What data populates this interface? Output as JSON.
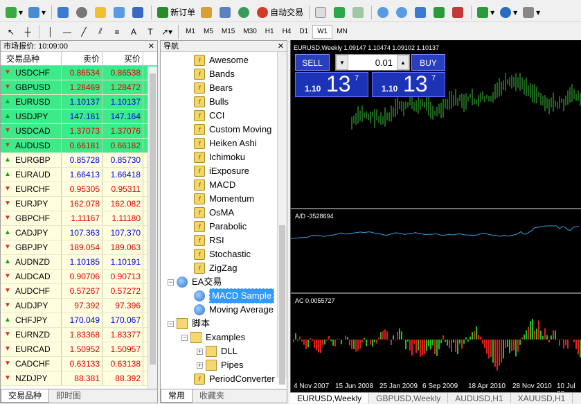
{
  "toolbar": {
    "new_order": "新订单",
    "auto_trading": "自动交易",
    "timeframes": [
      "M1",
      "M5",
      "M15",
      "M30",
      "H1",
      "H4",
      "D1",
      "W1",
      "MN"
    ],
    "active_timeframe": "W1"
  },
  "market_watch": {
    "title": "市场报价: 10:09:00",
    "col_symbol": "交易品种",
    "col_bid": "卖价",
    "col_ask": "买价",
    "rows": [
      {
        "symbol": "USDCHF",
        "bid": "0.86534",
        "ask": "0.86538",
        "dir": "down",
        "color": "red",
        "hl": true
      },
      {
        "symbol": "GBPUSD",
        "bid": "1.28469",
        "ask": "1.28472",
        "dir": "down",
        "color": "red",
        "hl": true
      },
      {
        "symbol": "EURUSD",
        "bid": "1.10137",
        "ask": "1.10137",
        "dir": "up",
        "color": "blue",
        "hl": true
      },
      {
        "symbol": "USDJPY",
        "bid": "147.161",
        "ask": "147.164",
        "dir": "up",
        "color": "blue",
        "hl": true
      },
      {
        "symbol": "USDCAD",
        "bid": "1.37073",
        "ask": "1.37076",
        "dir": "down",
        "color": "red",
        "hl": true
      },
      {
        "symbol": "AUDUSD",
        "bid": "0.66181",
        "ask": "0.66182",
        "dir": "down",
        "color": "red",
        "hl": true
      },
      {
        "symbol": "EURGBP",
        "bid": "0.85728",
        "ask": "0.85730",
        "dir": "up",
        "color": "blue",
        "hl": false
      },
      {
        "symbol": "EURAUD",
        "bid": "1.66413",
        "ask": "1.66418",
        "dir": "up",
        "color": "blue",
        "hl": false
      },
      {
        "symbol": "EURCHF",
        "bid": "0.95305",
        "ask": "0.95311",
        "dir": "down",
        "color": "red",
        "hl": false
      },
      {
        "symbol": "EURJPY",
        "bid": "162.078",
        "ask": "162.082",
        "dir": "down",
        "color": "red",
        "hl": false
      },
      {
        "symbol": "GBPCHF",
        "bid": "1.11167",
        "ask": "1.11180",
        "dir": "down",
        "color": "red",
        "hl": false
      },
      {
        "symbol": "CADJPY",
        "bid": "107.363",
        "ask": "107.370",
        "dir": "up",
        "color": "blue",
        "hl": false
      },
      {
        "symbol": "GBPJPY",
        "bid": "189.054",
        "ask": "189.063",
        "dir": "down",
        "color": "red",
        "hl": false
      },
      {
        "symbol": "AUDNZD",
        "bid": "1.10185",
        "ask": "1.10191",
        "dir": "up",
        "color": "blue",
        "hl": false
      },
      {
        "symbol": "AUDCAD",
        "bid": "0.90706",
        "ask": "0.90713",
        "dir": "down",
        "color": "red",
        "hl": false
      },
      {
        "symbol": "AUDCHF",
        "bid": "0.57267",
        "ask": "0.57272",
        "dir": "down",
        "color": "red",
        "hl": false
      },
      {
        "symbol": "AUDJPY",
        "bid": "97.392",
        "ask": "97.396",
        "dir": "down",
        "color": "red",
        "hl": false
      },
      {
        "symbol": "CHFJPY",
        "bid": "170.049",
        "ask": "170.067",
        "dir": "up",
        "color": "blue",
        "hl": false
      },
      {
        "symbol": "EURNZD",
        "bid": "1.83368",
        "ask": "1.83377",
        "dir": "down",
        "color": "red",
        "hl": false
      },
      {
        "symbol": "EURCAD",
        "bid": "1.50952",
        "ask": "1.50957",
        "dir": "down",
        "color": "red",
        "hl": false
      },
      {
        "symbol": "CADCHF",
        "bid": "0.63133",
        "ask": "0.63138",
        "dir": "down",
        "color": "red",
        "hl": false
      },
      {
        "symbol": "NZDJPY",
        "bid": "88.381",
        "ask": "88.392",
        "dir": "down",
        "color": "red",
        "hl": false
      }
    ],
    "tabs": [
      "交易品种",
      "即时图"
    ]
  },
  "navigator": {
    "title": "导航",
    "indicators": [
      "Awesome",
      "Bands",
      "Bears",
      "Bulls",
      "CCI",
      "Custom Moving",
      "Heiken Ashi",
      "Ichimoku",
      "iExposure",
      "MACD",
      "Momentum",
      "OsMA",
      "Parabolic",
      "RSI",
      "Stochastic",
      "ZigZag"
    ],
    "ea_group": "EA交易",
    "ea_items": [
      "MACD Sample",
      "Moving Average"
    ],
    "scripts_group": "脚本",
    "examples": "Examples",
    "dll": "DLL",
    "pipes": "Pipes",
    "period_converter": "PeriodConverter",
    "tabs": [
      "常用",
      "收藏夹"
    ]
  },
  "chart": {
    "title": "EURUSD,Weekly  1.09147 1.10474 1.09102 1.10137",
    "ad_label": "A/D -3528694",
    "ac_label": "AC 0.0055727",
    "sell": "SELL",
    "buy": "BUY",
    "lot": "0.01",
    "bid_prefix": "1.10",
    "bid_big": "13",
    "bid_sup": "7",
    "ask_prefix": "1.10",
    "ask_big": "13",
    "ask_sup": "7",
    "dates": [
      "4 Nov 2007",
      "15 Jun 2008",
      "25 Jan 2009",
      "6 Sep 2009",
      "18 Apr 2010",
      "28 Nov 2010",
      "10 Jul 20"
    ],
    "tabs": [
      "EURUSD,Weekly",
      "GBPUSD,Weekly",
      "AUDUSD,H1",
      "XAUUSD,H1"
    ]
  }
}
